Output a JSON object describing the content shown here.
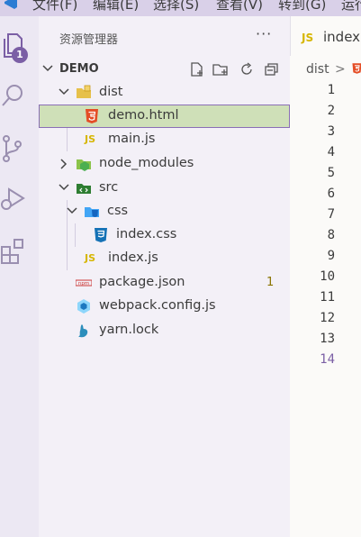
{
  "menu": [
    "文件(F)",
    "编辑(E)",
    "选择(S)",
    "查看(V)",
    "转到(G)",
    "运行"
  ],
  "activity_bar": {
    "explorer_badge": "1",
    "icons": [
      "files-icon",
      "search-icon",
      "source-control-icon",
      "run-debug-icon",
      "extensions-icon"
    ]
  },
  "sidebar": {
    "title": "资源管理器",
    "more": "···",
    "section": "DEMO",
    "tree": [
      {
        "name": "dist",
        "type": "folder",
        "expanded": true,
        "depth": 1
      },
      {
        "name": "demo.html",
        "type": "html",
        "depth": 2,
        "selected": true
      },
      {
        "name": "main.js",
        "type": "js",
        "depth": 2
      },
      {
        "name": "node_modules",
        "type": "folder",
        "expanded": false,
        "depth": 1
      },
      {
        "name": "src",
        "type": "folder",
        "expanded": true,
        "depth": 1
      },
      {
        "name": "css",
        "type": "folder",
        "expanded": true,
        "depth": 2
      },
      {
        "name": "index.css",
        "type": "css",
        "depth": 3
      },
      {
        "name": "index.js",
        "type": "js",
        "depth": 2
      },
      {
        "name": "package.json",
        "type": "npm",
        "depth": 1,
        "count": "1"
      },
      {
        "name": "webpack.config.js",
        "type": "webpack",
        "depth": 1
      },
      {
        "name": "yarn.lock",
        "type": "yarn",
        "depth": 1
      }
    ]
  },
  "editor": {
    "tab": {
      "icon": "JS",
      "name": "index."
    },
    "breadcrumb": {
      "folder": "dist",
      "sep": ">",
      "icon": "5"
    },
    "line_numbers": [
      "1",
      "2",
      "3",
      "4",
      "5",
      "6",
      "7",
      "8",
      "9",
      "10",
      "11",
      "12",
      "13",
      "14"
    ],
    "active_line": "14"
  },
  "colors": {
    "accent": "#7b5fa5",
    "selection": "#cfe0b8",
    "js_yellow": "#d6b600",
    "html_orange": "#e44d26",
    "css_blue": "#1572b6"
  }
}
